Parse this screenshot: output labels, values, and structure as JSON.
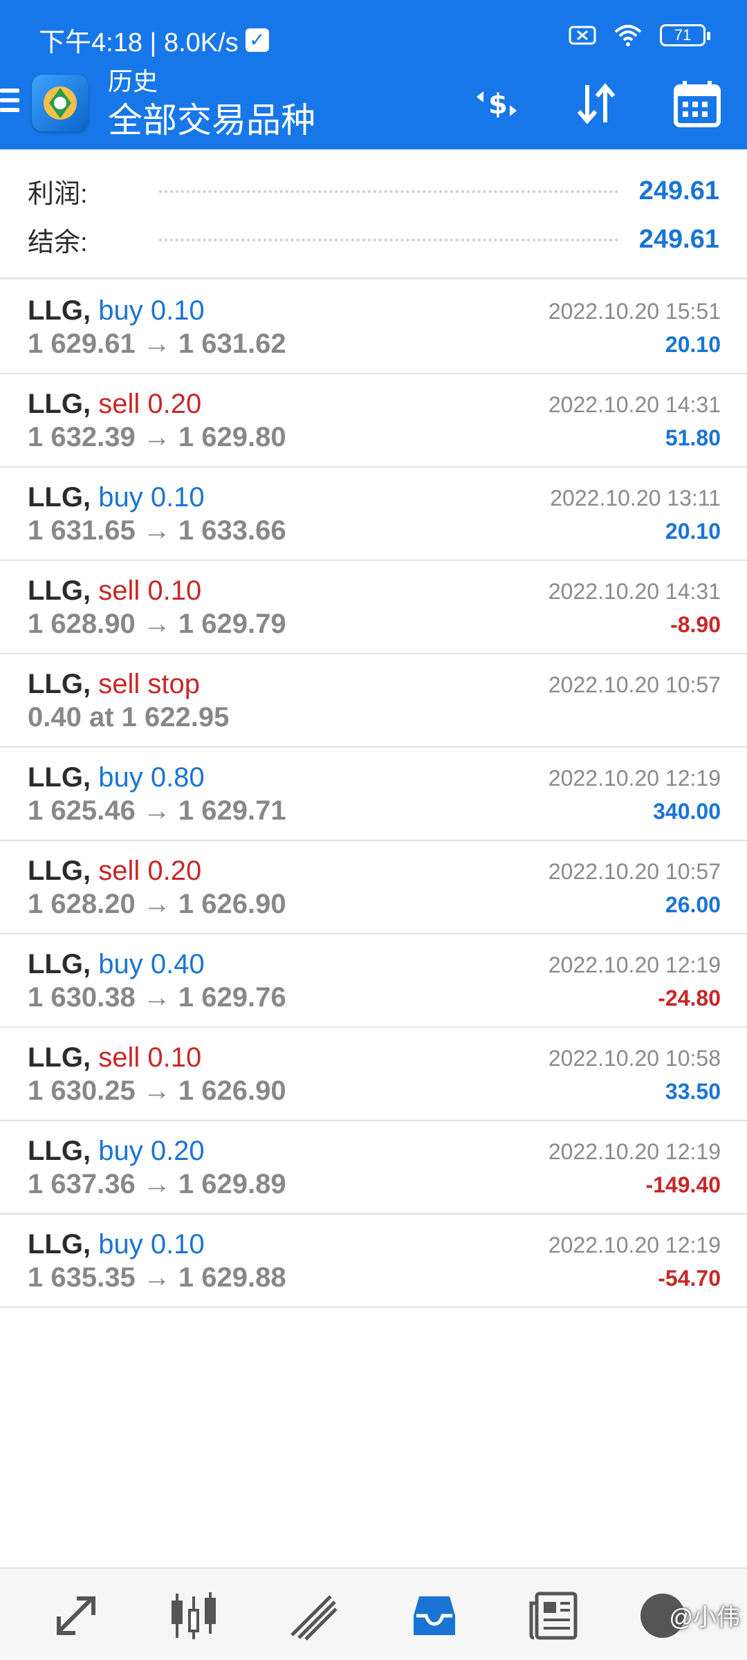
{
  "status_bar": {
    "time_speed": "下午4:18 | 8.0K/s",
    "battery": "71"
  },
  "toolbar": {
    "title_small": "历史",
    "title_large": "全部交易品种"
  },
  "summary": {
    "profit_label": "利润:",
    "profit_value": "249.61",
    "balance_label": "结余:",
    "balance_value": "249.61"
  },
  "trades": [
    {
      "symbol": "LLG,",
      "action": "buy 0.10",
      "side": "buy",
      "line2": "1 629.61 → 1 631.62",
      "time": "2022.10.20 15:51",
      "profit": "20.10"
    },
    {
      "symbol": "LLG,",
      "action": "sell 0.20",
      "side": "sell",
      "line2": "1 632.39 → 1 629.80",
      "time": "2022.10.20 14:31",
      "profit": "51.80"
    },
    {
      "symbol": "LLG,",
      "action": "buy 0.10",
      "side": "buy",
      "line2": "1 631.65 → 1 633.66",
      "time": "2022.10.20 13:11",
      "profit": "20.10"
    },
    {
      "symbol": "LLG,",
      "action": "sell 0.10",
      "side": "sell",
      "line2": "1 628.90 → 1 629.79",
      "time": "2022.10.20 14:31",
      "profit": "-8.90"
    },
    {
      "symbol": "LLG,",
      "action": "sell stop",
      "side": "sell",
      "line2": "0.40 at 1 622.95",
      "time": "2022.10.20 10:57",
      "profit": ""
    },
    {
      "symbol": "LLG,",
      "action": "buy 0.80",
      "side": "buy",
      "line2": "1 625.46 → 1 629.71",
      "time": "2022.10.20 12:19",
      "profit": "340.00"
    },
    {
      "symbol": "LLG,",
      "action": "sell 0.20",
      "side": "sell",
      "line2": "1 628.20 → 1 626.90",
      "time": "2022.10.20 10:57",
      "profit": "26.00"
    },
    {
      "symbol": "LLG,",
      "action": "buy 0.40",
      "side": "buy",
      "line2": "1 630.38 → 1 629.76",
      "time": "2022.10.20 12:19",
      "profit": "-24.80"
    },
    {
      "symbol": "LLG,",
      "action": "sell 0.10",
      "side": "sell",
      "line2": "1 630.25 → 1 626.90",
      "time": "2022.10.20 10:58",
      "profit": "33.50"
    },
    {
      "symbol": "LLG,",
      "action": "buy 0.20",
      "side": "buy",
      "line2": "1 637.36 → 1 629.89",
      "time": "2022.10.20 12:19",
      "profit": "-149.40"
    },
    {
      "symbol": "LLG,",
      "action": "buy 0.10",
      "side": "buy",
      "line2": "1 635.35 → 1 629.88",
      "time": "2022.10.20 12:19",
      "profit": "-54.70"
    }
  ],
  "bottom_nav": {
    "items": [
      "quotes-icon",
      "chart-candles-icon",
      "trade-icon",
      "history-icon",
      "news-icon",
      "settings-icon"
    ],
    "watermark": "@小伟"
  },
  "colors": {
    "header": "#1877e8",
    "positive": "#1a74d4",
    "negative": "#c62828",
    "muted": "#888888"
  }
}
